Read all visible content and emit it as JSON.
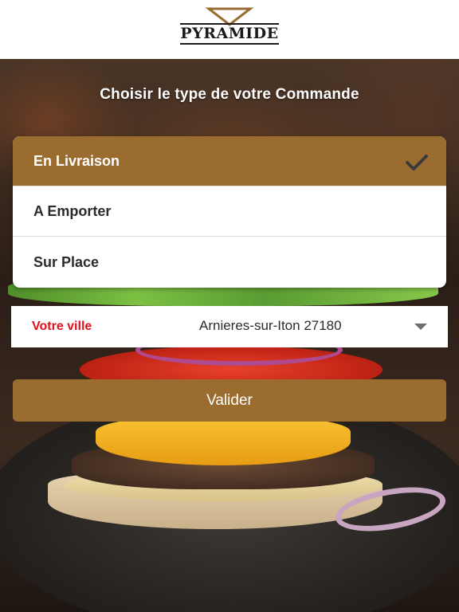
{
  "header": {
    "logo_text": "PYRAMIDE"
  },
  "page": {
    "subtitle": "Choisir le type de votre Commande"
  },
  "order_types": [
    {
      "label": "En Livraison",
      "selected": true
    },
    {
      "label": "A Emporter",
      "selected": false
    },
    {
      "label": "Sur Place",
      "selected": false
    }
  ],
  "city": {
    "label": "Votre ville",
    "value": "Arnieres-sur-Iton 27180"
  },
  "actions": {
    "validate_label": "Valider"
  },
  "colors": {
    "accent": "#9a6c2f",
    "city_label": "#e3111d"
  },
  "icons": {
    "selected_indicator": "checkmark-icon",
    "dropdown": "chevron-down-icon"
  }
}
